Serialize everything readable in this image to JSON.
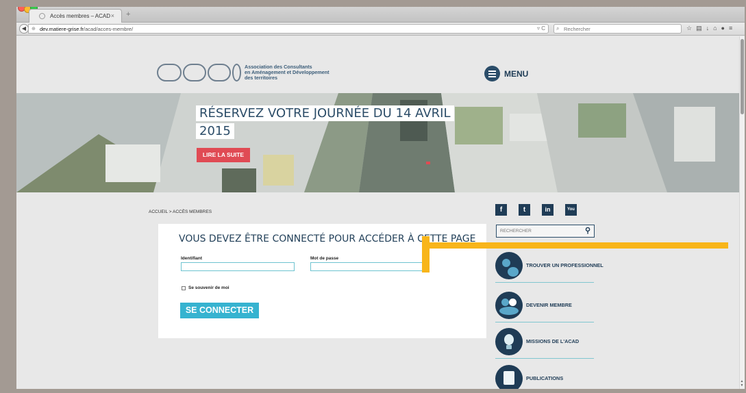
{
  "browser": {
    "tab_title": "Accès membres – ACAD",
    "tab_close": "×",
    "new_tab": "+",
    "url_host": "dev.matiere-grise.fr",
    "url_path": "/acad/acces-membre/",
    "search_placeholder": "Rechercher",
    "toolbar_icons": [
      "star-icon",
      "bookmarks-icon",
      "download-icon",
      "home-icon",
      "chat-icon",
      "hamburger-icon"
    ]
  },
  "header": {
    "logo_line1": "Association des Consultants",
    "logo_line2": "en Aménagement et Développement",
    "logo_line3": "des territoires",
    "menu_label": "MENU"
  },
  "hero": {
    "title_line1": "RÉSERVEZ VOTRE JOURNÉE DU 14 AVRIL",
    "title_line2": "2015",
    "cta_label": "LIRE LA SUITE"
  },
  "breadcrumb": "ACCUEIL > ACCÈS MEMBRES",
  "login": {
    "title": "VOUS DEVEZ ÊTRE CONNECTÉ POUR ACCÉDER À CETTE PAGE",
    "username_label": "Identifiant",
    "username_value": "",
    "password_label": "Mot de passe",
    "password_value": "",
    "remember_label": "Se souvenir de moi",
    "submit_label": "SE CONNECTER"
  },
  "sidebar": {
    "social": [
      {
        "icon": "facebook-icon",
        "glyph": "f"
      },
      {
        "icon": "twitter-icon",
        "glyph": "t"
      },
      {
        "icon": "linkedin-icon",
        "glyph": "in"
      },
      {
        "icon": "youtube-icon",
        "glyph": "You"
      }
    ],
    "search_placeholder": "RECHERCHER",
    "items": [
      {
        "label": "TROUVER UN PROFESSIONNEL",
        "icon": "people-icon"
      },
      {
        "label": "DEVENIR MEMBRE",
        "icon": "members-icon"
      },
      {
        "label": "MISSIONS DE L'ACAD",
        "icon": "lightbulb-icon"
      },
      {
        "label": "PUBLICATIONS",
        "icon": "document-icon"
      }
    ]
  },
  "colors": {
    "brand_dark": "#1f3c56",
    "accent_red": "#e04b54",
    "accent_cyan": "#36b3d0",
    "annotation": "#f8b51a"
  }
}
